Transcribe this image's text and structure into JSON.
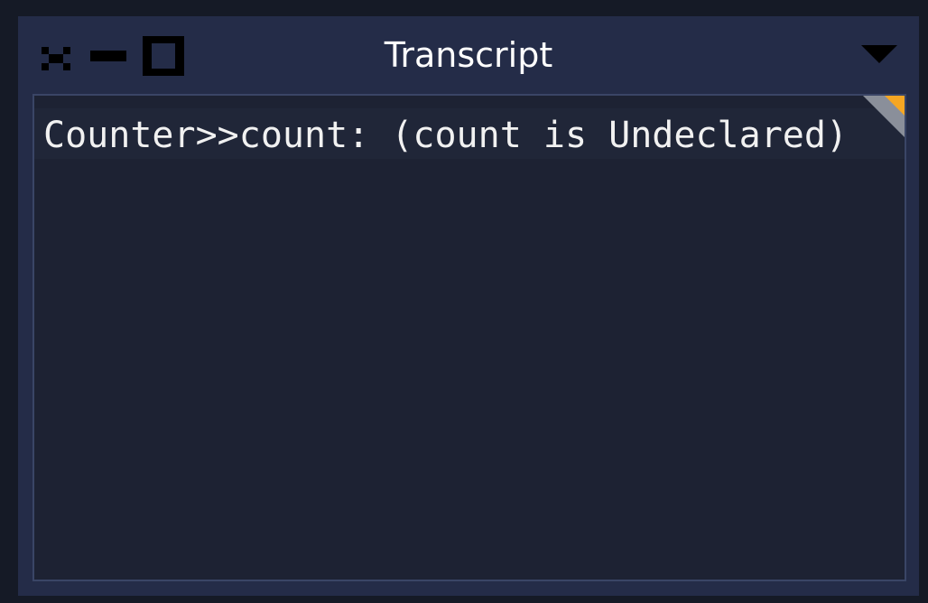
{
  "window": {
    "title": "Transcript",
    "controls": {
      "close": "close-icon",
      "minimize": "minimize-icon",
      "maximize": "maximize-icon",
      "menu": "dropdown-triangle-icon"
    }
  },
  "transcript": {
    "lines": [
      "Counter>>count: (count is Undeclared)"
    ]
  },
  "colors": {
    "window_frame": "#242c48",
    "content_background": "#1d2233",
    "text": "#f1f1f1",
    "corner_accent": "#f5a623"
  }
}
